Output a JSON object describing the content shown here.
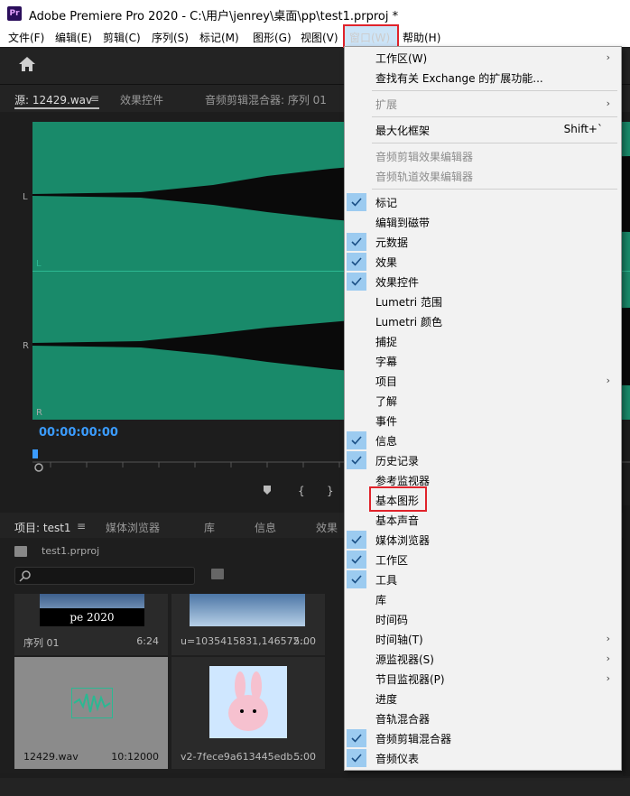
{
  "window": {
    "title": "Adobe Premiere Pro 2020 - C:\\用户\\jenrey\\桌面\\pp\\test1.prproj *",
    "app_icon_text": "Pr"
  },
  "menubar": [
    {
      "label": "文件(F)"
    },
    {
      "label": "编辑(E)"
    },
    {
      "label": "剪辑(C)"
    },
    {
      "label": "序列(S)"
    },
    {
      "label": "标记(M)"
    },
    {
      "label": "图形(G)"
    },
    {
      "label": "视图(V)"
    },
    {
      "label": "窗口(W)"
    },
    {
      "label": "帮助(H)"
    }
  ],
  "source_panel": {
    "tabs": [
      "源: 12429.wav",
      "效果控件",
      "音频剪辑混合器: 序列 01"
    ],
    "channel_labels": {
      "l": "L",
      "l2": "L",
      "r": "R",
      "r2": "R"
    },
    "timecode": "00:00:00:00"
  },
  "project_panel": {
    "tabs": [
      "项目: test1",
      "媒体浏览器",
      "库",
      "信息",
      "效果"
    ],
    "project_file": "test1.prproj",
    "items": [
      {
        "name": "序列 01",
        "duration": "6:24",
        "thumb_text": "pe 2020"
      },
      {
        "name": "u=1035415831,146572…",
        "duration": "5:00"
      },
      {
        "name": "12429.wav",
        "duration": "10:12000"
      },
      {
        "name": "v2-7fece9a613445edb…",
        "duration": "5:00"
      }
    ]
  },
  "window_menu": {
    "items": [
      {
        "label": "工作区(W)",
        "submenu": true
      },
      {
        "label": "查找有关 Exchange 的扩展功能..."
      },
      {
        "sep": true
      },
      {
        "label": "扩展",
        "submenu": true,
        "disabled": true
      },
      {
        "sep": true
      },
      {
        "label": "最大化框架",
        "shortcut": "Shift+`"
      },
      {
        "sep": true
      },
      {
        "label": "音频剪辑效果编辑器",
        "disabled": true
      },
      {
        "label": "音频轨道效果编辑器",
        "disabled": true
      },
      {
        "sep": true
      },
      {
        "label": "标记",
        "checked": true
      },
      {
        "label": "编辑到磁带"
      },
      {
        "label": "元数据",
        "checked": true
      },
      {
        "label": "效果",
        "checked": true
      },
      {
        "label": "效果控件",
        "checked": true
      },
      {
        "label": "Lumetri 范围"
      },
      {
        "label": "Lumetri 颜色"
      },
      {
        "label": "捕捉"
      },
      {
        "label": "字幕"
      },
      {
        "label": "项目",
        "submenu": true
      },
      {
        "label": "了解"
      },
      {
        "label": "事件"
      },
      {
        "label": "信息",
        "checked": true
      },
      {
        "label": "历史记录",
        "checked": true
      },
      {
        "label": "参考监视器"
      },
      {
        "label": "基本图形"
      },
      {
        "label": "基本声音"
      },
      {
        "label": "媒体浏览器",
        "checked": true
      },
      {
        "label": "工作区",
        "checked": true
      },
      {
        "label": "工具",
        "checked": true
      },
      {
        "label": "库"
      },
      {
        "label": "时间码"
      },
      {
        "label": "时间轴(T)",
        "submenu": true
      },
      {
        "label": "源监视器(S)",
        "submenu": true
      },
      {
        "label": "节目监视器(P)",
        "submenu": true
      },
      {
        "label": "进度"
      },
      {
        "label": "音轨混合器"
      },
      {
        "label": "音频剪辑混合器",
        "checked": true
      },
      {
        "label": "音频仪表",
        "checked": true
      }
    ]
  },
  "colors": {
    "accent_highlight": "#e0232b",
    "waveform_bg": "#198a6a",
    "timecode": "#3b9cff",
    "check_bg": "#9ccbf0"
  }
}
